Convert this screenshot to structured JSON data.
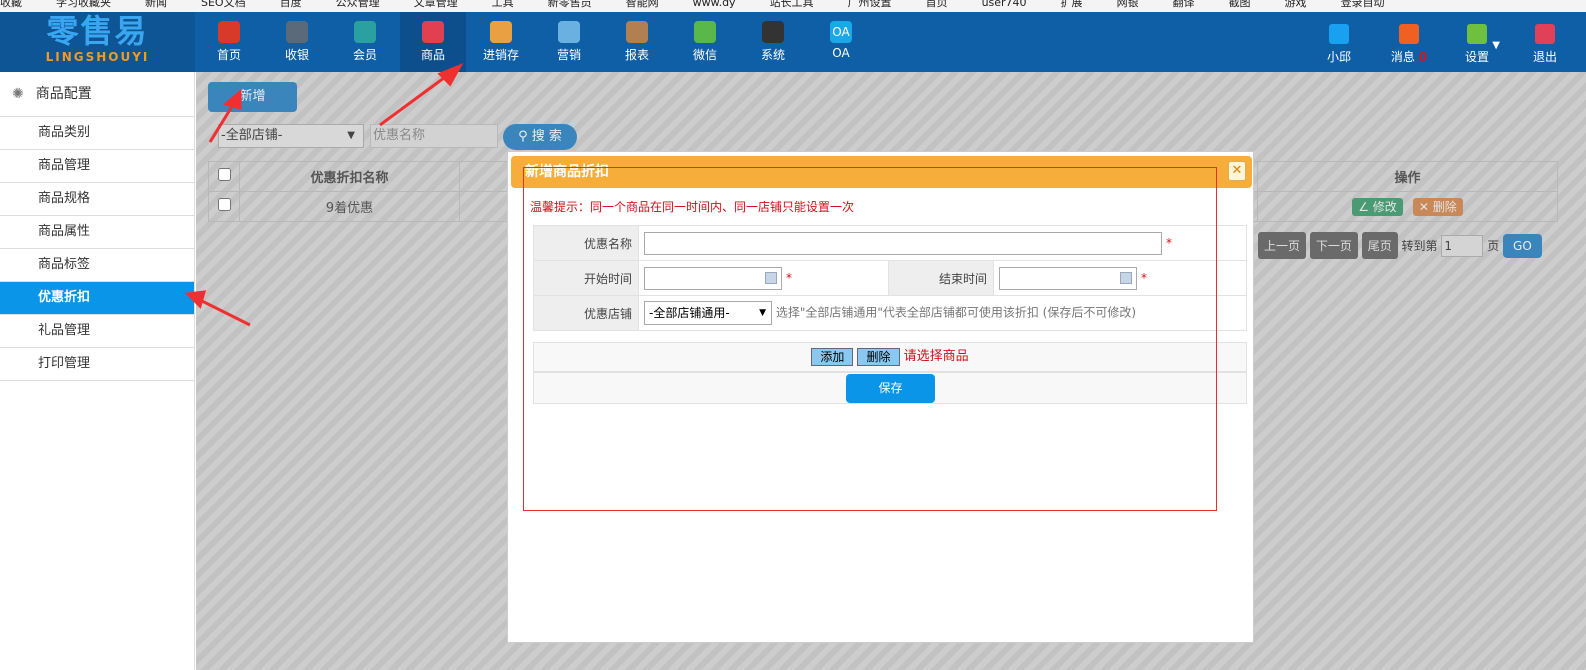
{
  "bookmarks": [
    "收藏",
    "学习收藏夹",
    "新闻",
    "SEO文档",
    "百度",
    "公众管理",
    "文章管理",
    "工具",
    "新零售员",
    "智能网",
    "www.dy",
    "站长工具",
    "广州设置",
    "首页",
    "user740",
    "扩展",
    "网银",
    "翻译",
    "截图",
    "游戏",
    "登录自动"
  ],
  "logo": {
    "cn": "零售易",
    "en": "LINGSHOUYI"
  },
  "nav": [
    {
      "label": "首页",
      "icon": "home-icon",
      "color": "#d83a2a"
    },
    {
      "label": "收银",
      "icon": "cash-register-icon",
      "color": "#5a6a7a"
    },
    {
      "label": "会员",
      "icon": "member-icon",
      "color": "#2aa0a0"
    },
    {
      "label": "商品",
      "icon": "product-icon",
      "color": "#e04050"
    },
    {
      "label": "进销存",
      "icon": "inventory-icon",
      "color": "#e8a040"
    },
    {
      "label": "营销",
      "icon": "megaphone-icon",
      "color": "#6ab0e0"
    },
    {
      "label": "报表",
      "icon": "report-icon",
      "color": "#b08050"
    },
    {
      "label": "微信",
      "icon": "wechat-icon",
      "color": "#5ab84a"
    },
    {
      "label": "系统",
      "icon": "monitor-icon",
      "color": "#333333"
    },
    {
      "label": "OA",
      "icon": "oa-icon",
      "color": "#1aa8e8"
    }
  ],
  "active_nav": "商品",
  "right_nav": [
    {
      "label": "小邱",
      "icon": "user-icon",
      "color": "#1aa0f0"
    },
    {
      "label": "消息",
      "badge": "0",
      "icon": "bell-icon",
      "color": "#f06020"
    },
    {
      "label": "设置",
      "icon": "gear-icon",
      "color": "#70c040"
    },
    {
      "label": "退出",
      "icon": "logout-icon",
      "color": "#e04058"
    }
  ],
  "sidebar": {
    "title": "商品配置",
    "items": [
      "商品类别",
      "商品管理",
      "商品规格",
      "商品属性",
      "商品标签",
      "优惠折扣",
      "礼品管理",
      "打印管理"
    ],
    "active": "优惠折扣"
  },
  "toolbar": {
    "add": "新增",
    "store_select": "-全部店铺-",
    "name_placeholder": "优惠名称",
    "search": "搜 索"
  },
  "grid": {
    "headers": [
      "优惠折扣名称",
      "操作"
    ],
    "rows": [
      {
        "name": "9着优惠",
        "edit": "修改",
        "delete": "删除"
      }
    ]
  },
  "pager": {
    "prev": "上一页",
    "next": "下一页",
    "last": "尾页",
    "goto": "转到第",
    "page": "1",
    "unit": "页",
    "go": "GO"
  },
  "dialog": {
    "title": "新增商品折扣",
    "tip": "温馨提示：同一个商品在同一时间内、同一店铺只能设置一次",
    "name_label": "优惠名称",
    "name_value": "",
    "start_label": "开始时间",
    "start_value": "",
    "end_label": "结束时间",
    "end_value": "",
    "store_label": "优惠店铺",
    "store_value": "-全部店铺通用-",
    "store_hint": "选择\"全部店铺通用\"代表全部店铺都可使用该折扣 (保存后不可修改)",
    "required": "*",
    "add": "添加",
    "delete": "删除",
    "select_hint": "请选择商品",
    "save": "保存"
  },
  "colors": {
    "header": "#0f5fa6",
    "accent": "#0a95e8",
    "dialog_title": "#f7ad3a",
    "warning": "#d0101a"
  }
}
